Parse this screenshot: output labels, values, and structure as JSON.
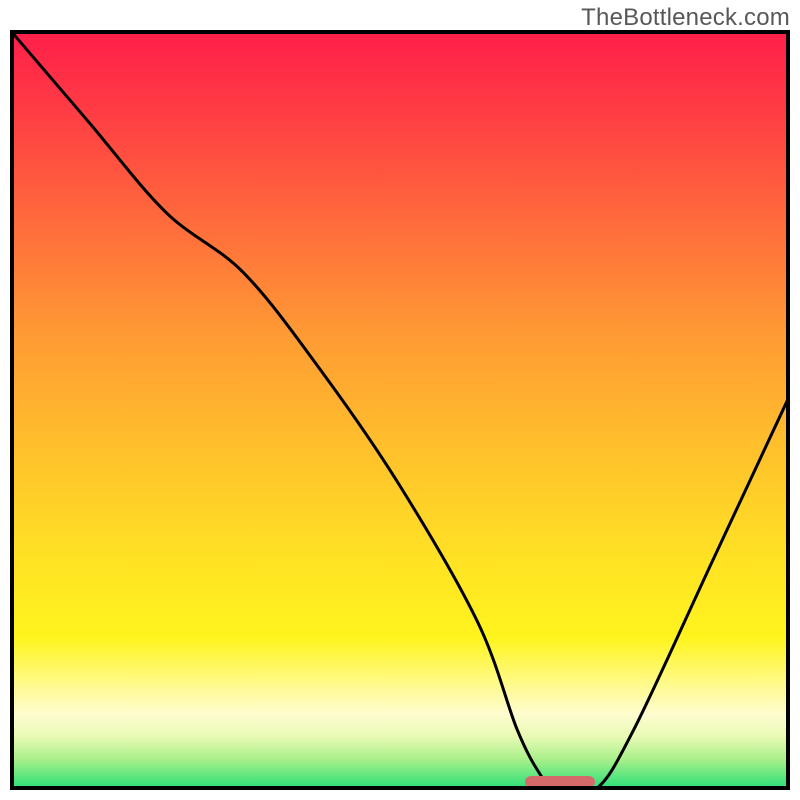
{
  "watermark": "TheBottleneck.com",
  "chart_data": {
    "type": "line",
    "title": "",
    "xlabel": "",
    "ylabel": "",
    "xlim": [
      0,
      100
    ],
    "ylim": [
      0,
      100
    ],
    "x": [
      0,
      10,
      20,
      30,
      40,
      50,
      60,
      65,
      68,
      70,
      75,
      80,
      90,
      100
    ],
    "values": [
      100,
      88,
      76,
      68,
      55,
      40,
      22,
      8,
      2,
      0,
      0,
      8,
      30,
      52
    ],
    "marker": {
      "x_start": 66,
      "x_end": 75,
      "y": 0
    },
    "gradient_stops": [
      {
        "pos": 0.0,
        "color": "#ff1e4a"
      },
      {
        "pos": 0.1,
        "color": "#ff3a44"
      },
      {
        "pos": 0.25,
        "color": "#ff6a3c"
      },
      {
        "pos": 0.4,
        "color": "#ff9a34"
      },
      {
        "pos": 0.55,
        "color": "#ffc02c"
      },
      {
        "pos": 0.7,
        "color": "#ffe324"
      },
      {
        "pos": 0.8,
        "color": "#fff41e"
      },
      {
        "pos": 0.86,
        "color": "#fffa8a"
      },
      {
        "pos": 0.9,
        "color": "#fffcd0"
      },
      {
        "pos": 0.93,
        "color": "#e8fab4"
      },
      {
        "pos": 0.96,
        "color": "#a8f08a"
      },
      {
        "pos": 1.0,
        "color": "#22dd77"
      }
    ]
  }
}
